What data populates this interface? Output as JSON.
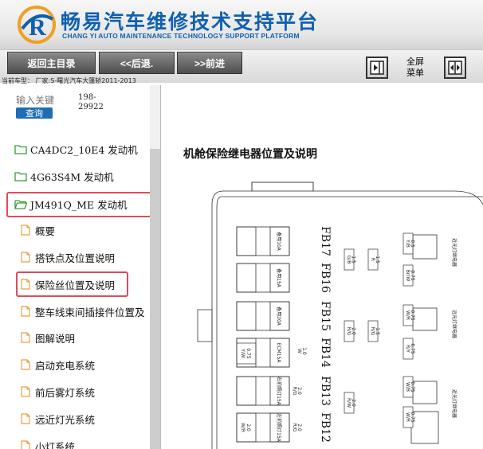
{
  "header": {
    "title": "畅易汽车维修技术支持平台",
    "subtitle": "CHANG YI AUTO MAINTENANCE TECHNOLOGY SUPPORT PLATFORM",
    "logo_letter": "R"
  },
  "toolbar": {
    "home_label": "返回主目录",
    "back_label": "<<后退.",
    "forward_label": ">>前进",
    "fullscreen_label_line1": "全屏",
    "fullscreen_label_line2": "菜单"
  },
  "current_model": "当前车型： 厂家:S-曙光汽车大篷轿2011-2013",
  "search": {
    "placeholder": "输入关键",
    "button_label": "查询",
    "code_line1": "198-",
    "code_line2": "29922"
  },
  "tree": {
    "folders": [
      {
        "label": "CA4DC2_10E4 发动机"
      },
      {
        "label": "4G63S4M 发动机"
      },
      {
        "label": "JM491Q_ME 发动机"
      }
    ],
    "pages": [
      {
        "label": "概要"
      },
      {
        "label": "搭铁点及位置说明"
      },
      {
        "label": "保险丝位置及说明"
      },
      {
        "label": "整车线束间插接件位置及"
      },
      {
        "label": "图解说明"
      },
      {
        "label": "启动充电系统"
      },
      {
        "label": "前后雾灯系统"
      },
      {
        "label": "远近灯光系统"
      },
      {
        "label": "小灯系统"
      }
    ]
  },
  "content": {
    "title": "机舱保险继电器位置及说明",
    "fuses": {
      "fb17": {
        "id": "FB17",
        "label": "备用10A"
      },
      "fb16": {
        "id": "FB16",
        "label": "备用15A"
      },
      "fb15": {
        "id": "FB15",
        "label": "备用20A"
      },
      "fb14": {
        "id": "FB14",
        "label": "ECM15A"
      },
      "fb13": {
        "id": "FB13",
        "label": "右前照灯15A"
      },
      "fb12": {
        "id": "FB12",
        "label": "左前照灯15A"
      }
    },
    "wires": {
      "w1": {
        "color": "Y/B",
        "size": "0.5"
      },
      "w2": {
        "color": "Br/W",
        "size": "0.75"
      },
      "w3": {
        "color": "G/B",
        "size": "1.5"
      },
      "w4": {
        "color": "R",
        "size": "1.5"
      },
      "w5": {
        "color": "W/R",
        "size": "0.75"
      },
      "w6": {
        "color": "R/G",
        "size": "2.0"
      },
      "w7": {
        "color": "R/G",
        "size": "1.5"
      },
      "w8": {
        "color": "R/Y",
        "size": "0.75"
      },
      "w9": {
        "color": "Y/W",
        "size": "0.75"
      },
      "w10": {
        "color": "W",
        "size": "1.0"
      },
      "w11": {
        "color": "R/G",
        "size": "2.0"
      },
      "w12": {
        "color": "W/B",
        "size": "0.75"
      },
      "w13": {
        "color": "R/W",
        "size": "2.0"
      },
      "w14": {
        "color": "W/R",
        "size": "0.75"
      },
      "w15": {
        "color": "W/R",
        "size": "2.0"
      },
      "w16": {
        "color": "R/G",
        "size": "2.0"
      }
    },
    "relays": {
      "r1": "近光灯继电器",
      "r2": "远光灯继电器",
      "r3": "近光灯继电器"
    }
  },
  "colors": {
    "brand": "#1060b0",
    "highlight": "#e04a5a",
    "search_button": "#1f6db5"
  }
}
